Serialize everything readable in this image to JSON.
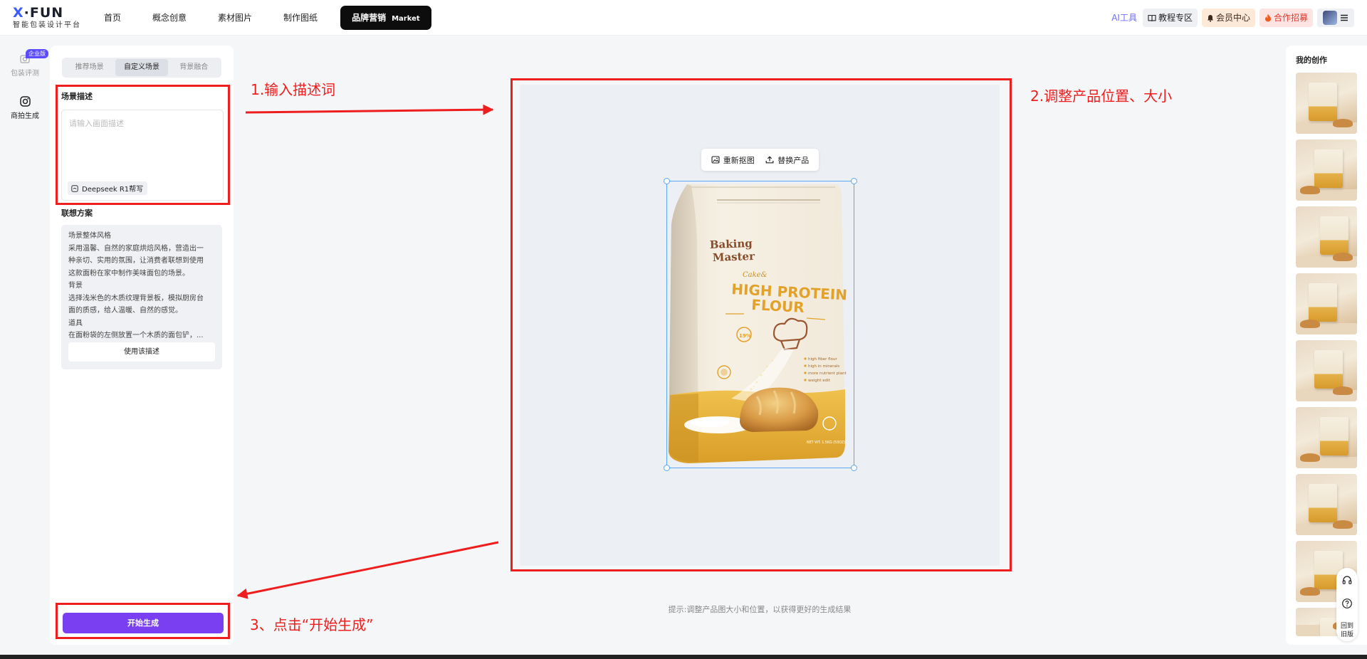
{
  "logo": {
    "mark_x": "X",
    "mark_dot": "·",
    "mark_rest": "FUN",
    "subtitle": "智能包装设计平台"
  },
  "nav": {
    "items": [
      "首页",
      "概念创意",
      "素材图片",
      "制作图纸"
    ],
    "active_label": "品牌营销",
    "active_tag": "Market"
  },
  "right_nav": {
    "ai_tools": "AI工具",
    "tutorial": "教程专区",
    "vip": "会员中心",
    "coop": "合作招募"
  },
  "rail": {
    "badge": "企业版",
    "items": [
      "包装评测",
      "商拍生成"
    ]
  },
  "panel": {
    "tabs": [
      "推荐场景",
      "自定义场景",
      "背景融合"
    ],
    "active_tab": 1,
    "scene_title": "场景描述",
    "desc_placeholder": "请输入画面描述",
    "deepseek_label": "Deepseek R1帮写",
    "plan_title": "联想方案",
    "plan_lines": [
      "场景整体风格",
      "采用温馨、自然的家庭烘焙风格，营造出一",
      "种亲切、实用的氛围，让消费者联想到使用",
      "这款面粉在家中制作美味面包的场景。",
      "背景",
      "选择浅米色的木质纹理背景板，模拟厨房台",
      "面的质感，给人温暖、自然的感觉。",
      "道具",
      "在面粉袋的左侧放置一个木质的面包铲，..."
    ],
    "use_desc": "使用该描述",
    "generate": "开始生成"
  },
  "canvas": {
    "recut": "重新抠图",
    "replace": "替换产品",
    "hint": "提示:调整产品图大小和位置，以获得更好的生成结果"
  },
  "product": {
    "brand_line1": "Baking",
    "brand_line2": "Master",
    "script": "Cake&",
    "title_line1": "HIGH PROTEIN",
    "title_line2": "FLOUR",
    "badge": "19%",
    "features": [
      "high fiber flour",
      "high in minerals",
      "more nutrient plant",
      "weight edit"
    ],
    "net": "NET WT. 1.5KG (53OZ)"
  },
  "annotations": {
    "step1": "1.输入描述词",
    "step2": "2.调整产品位置、大小",
    "step3": "3、点击“开始生成”"
  },
  "right_panel": {
    "title": "我的创作",
    "thumb_count": 9
  },
  "floater": {
    "back_old": "回到旧版"
  },
  "colors": {
    "accent": "#7b3ff2",
    "annotation": "#ee1e1e",
    "selection": "#5aa8f2",
    "flour_yellow": "#e9b43c"
  }
}
